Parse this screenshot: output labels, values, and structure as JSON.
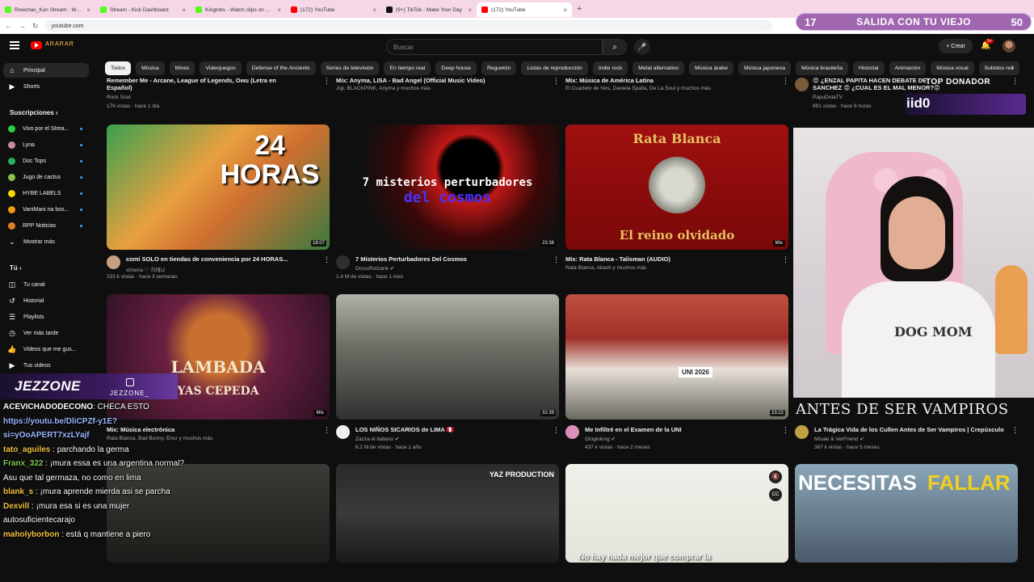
{
  "browser": {
    "tabs": [
      {
        "title": "Rowchas_Kun Stream · Watch L...",
        "color": "#53fc18",
        "active": false
      },
      {
        "title": "Stream - Kick Dashboard",
        "color": "#53fc18",
        "active": false
      },
      {
        "title": "Kingtoks - Watch clips on Kick",
        "color": "#53fc18",
        "active": false
      },
      {
        "title": "(172) YouTube",
        "color": "#ff0000",
        "active": false
      },
      {
        "title": "(9+) TikTok - Make Your Day",
        "color": "#111111",
        "active": false
      },
      {
        "title": "(172) YouTube",
        "color": "#ff0000",
        "active": true
      }
    ],
    "new_tab": "+",
    "url": "youtube.com"
  },
  "stream_banner": {
    "left": "17",
    "title": "SALIDA CON TU VIEJO",
    "right": "50"
  },
  "header": {
    "logo_text": "ᴬᴿᴬᴿᴬᴿ",
    "search_placeholder": "Buscar",
    "create_label": "Crear",
    "notif_badge": "9+"
  },
  "chips": [
    "Todos",
    "Música",
    "Mixes",
    "Videojuegos",
    "Defense of the Ancients",
    "Series de televisión",
    "En tiempo real",
    "Deep house",
    "Reguetón",
    "Listas de reproducción",
    "Indie rock",
    "Metal alternativo",
    "Música árabe",
    "Música japonesa",
    "Música brasileña",
    "Historial",
    "Animación",
    "Música vocal",
    "Subidos rec"
  ],
  "sidebar": {
    "top": [
      {
        "label": "Principal",
        "icon": "home-icon",
        "glyph": "⌂"
      },
      {
        "label": "Shorts",
        "icon": "shorts-icon",
        "glyph": "▶"
      }
    ],
    "subs_heading": "Suscripciones",
    "subs": [
      {
        "label": "Vivo por el Strea...",
        "color": "#2ecc40"
      },
      {
        "label": "Lyna",
        "color": "#c98aa5"
      },
      {
        "label": "Doc Tops",
        "color": "#27ae60"
      },
      {
        "label": "Jugo de cactus",
        "color": "#8bc34a"
      },
      {
        "label": "HYBE LABELS",
        "color": "#f5d700"
      },
      {
        "label": "VaniMani na bos...",
        "color": "#f39c12"
      },
      {
        "label": "RPP Noticias",
        "color": "#e67e22"
      }
    ],
    "show_more": "Mostrar más",
    "you_heading": "Tú",
    "you": [
      {
        "label": "Tu canal",
        "icon": "channel-icon",
        "glyph": "◫"
      },
      {
        "label": "Historial",
        "icon": "history-icon",
        "glyph": "↺"
      },
      {
        "label": "Playlists",
        "icon": "playlists-icon",
        "glyph": "☰"
      },
      {
        "label": "Ver más tarde",
        "icon": "watch-later-icon",
        "glyph": "◷"
      },
      {
        "label": "Videos que me gus...",
        "icon": "liked-icon",
        "glyph": "👍"
      },
      {
        "label": "Tus videos",
        "icon": "your-videos-icon",
        "glyph": "▶"
      }
    ]
  },
  "row0": [
    {
      "title": "Remember Me - Arcane, League of Legends, Owu (Letra en",
      "line2": "Español)",
      "channel": "Rock Soul",
      "meta": "176 vistas · hace 1 día"
    },
    {
      "title": "Mix: Anyma, LISA - Bad Angel (Official Music Video)",
      "channel": "Joji, BLACKPINK, Anyma y muchos más"
    },
    {
      "title": "Mix: Música de América Latina",
      "channel": "El Cuarteto de Nos, Daniela Spalla, De La Soul y muchos más"
    },
    {
      "title": "😡 ¿ENZAL PAPITA HACEN DEBATE DE",
      "line2": "SANCHEZ 😡 ¿CUAL ES EL MAL MENOR?😡",
      "channel": "PapuDotaTV",
      "meta": "891 vistas · hace 8 horas"
    }
  ],
  "row1": [
    {
      "title": "comí SOLO en tiendas de conveniencia por 24 HORAS...",
      "channel": "ximena ♡ 히메나",
      "meta": "233 k vistas · hace 3 semanas",
      "duration": "18:07",
      "thumb_text": "24 HORAS"
    },
    {
      "title": "7 Misterios Perturbadores Del Cosmos",
      "channel": "DrossRotzank ✔",
      "meta": "1.4 M de vistas · hace 1 mes",
      "duration": "23:38",
      "thumb_text": "7 misterios perturbadores",
      "thumb_text2": "del cosmos"
    },
    {
      "title": "Mix: Rata Blanca - Talisman (AUDIO)",
      "channel": "Rata Blanca, Akash y muchos más",
      "mix": "Mix",
      "thumb_text": "Rata Blanca",
      "thumb_text2": "El reino olvidado"
    }
  ],
  "row2": [
    {
      "title": "Mix: Música electrónica",
      "channel": "Rata Blanca, Bad Bunny, Enur y muchos más",
      "mix": "Mix",
      "thumb_text": "LAMBADA",
      "thumb_text2": "YAS CEPEDA"
    },
    {
      "title": "LOS NIÑOS SICARIOS de LIMA 🇵🇪",
      "channel": "Zazza el italiano ✔",
      "meta": "6.2 M de vistas · hace 1 año",
      "duration": "32:39"
    },
    {
      "title": "Me Infiltré en el Examen de la UNI",
      "channel": "Glogloking ✔",
      "meta": "437 k vistas · hace 2 meses",
      "duration": "23:22",
      "thumb_text": "UNI 2026"
    },
    {
      "title": "La Trágica Vida de los Cullen Antes de Ser Vampiros | Crepúsculo",
      "channel": "Misaki & VerFriend ✔",
      "meta": "367 k vistas · hace 5 meses"
    }
  ],
  "row3": [
    {
      "thumb_text": ""
    },
    {
      "thumb_text": "YAZ PRODUCTION"
    },
    {
      "thumb_text": "No hay nada mejor que comprar la"
    },
    {
      "thumb_text": "NECESITAS",
      "thumb_text2": "FALLAR"
    }
  ],
  "overlay": {
    "top_donor_label": "TOP DONADOR",
    "top_donor_name": "iid0",
    "webcam_shirt": "DOG MOM",
    "antes_banner": "ANTES DE SER VAMPIROS"
  },
  "chat": {
    "logo": "JEZZONE",
    "handle": "JEZZONE_",
    "messages": [
      {
        "user": "ACEVICHADODECONO",
        "user_color": "#ffffff",
        "text": ": CHECA ESTO"
      },
      {
        "user": "https://youtu.be/DliCPZf-y1E?",
        "user_color": "#9ab6ff",
        "text": ""
      },
      {
        "user": "si=yOoAPERT7xzLYajf",
        "user_color": "#9ab6ff",
        "text": ""
      },
      {
        "user": "tato_aguiles",
        "user_color": "#f0c040",
        "text": " : parchando la germa"
      },
      {
        "user": "Franx_322",
        "user_color": "#7ec850",
        "text": " : ¡mura essa es una argentina normal?"
      },
      {
        "user": "",
        "user_color": "#ffffff",
        "text": "Asu que tal germaza, no como en lima"
      },
      {
        "user": "blank_s",
        "user_color": "#f0c040",
        "text": " : ¡mura aprende mierda asi se parcha"
      },
      {
        "user": "Dexvill",
        "user_color": "#f0c040",
        "text": " : ¡mura esa si es una mujer"
      },
      {
        "user": "",
        "user_color": "#ffffff",
        "text": "autosuficientecarajo"
      },
      {
        "user": "maholyborbon",
        "user_color": "#f0c040",
        "text": " : está q mantiene a piero"
      }
    ]
  }
}
